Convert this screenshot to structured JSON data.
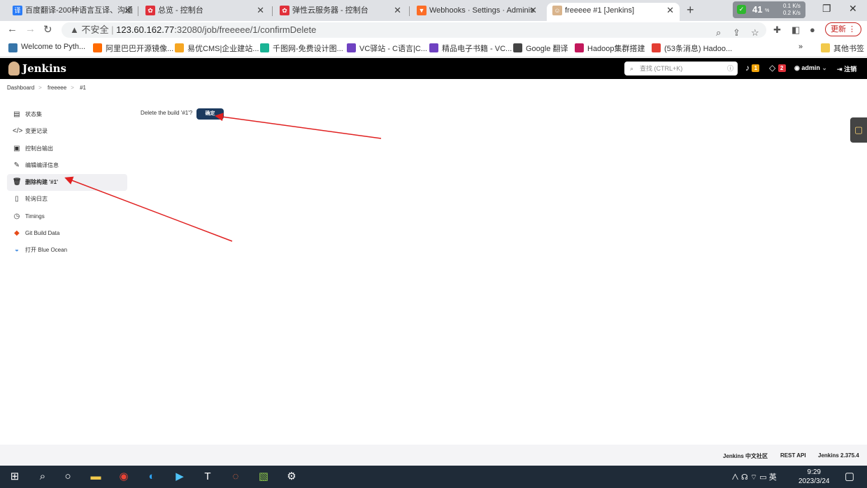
{
  "browser": {
    "tabs": [
      {
        "title": "百度翻译-200种语言互译、沟通",
        "icon": "baidu-translate-icon",
        "color": "#2b7cf7",
        "glyph": "译"
      },
      {
        "title": "总览 - 控制台",
        "icon": "huawei-cloud-icon",
        "color": "#e0303a",
        "glyph": "✿"
      },
      {
        "title": "弹性云服务器 - 控制台",
        "icon": "huawei-cloud-icon",
        "color": "#e0303a",
        "glyph": "✿"
      },
      {
        "title": "Webhooks · Settings · Adminis",
        "icon": "gitlab-icon",
        "color": "#fc6d26",
        "glyph": "▼"
      },
      {
        "title": "freeeee #1 [Jenkins]",
        "icon": "jenkins-icon",
        "color": "#d9b48c",
        "glyph": "☺"
      }
    ],
    "new_tab": "+",
    "ext_badge": {
      "value": "41",
      "unit": "%",
      "up": "0.1 K/s",
      "down": "0.2 K/s"
    },
    "address": {
      "security": "不安全",
      "host": "123.60.162.77",
      "rest": ":32080/job/freeeee/1/confirmDelete"
    },
    "update_label": "更新",
    "bookmarks": [
      {
        "label": "Welcome to Pyth...",
        "color": "#3775a9"
      },
      {
        "label": "阿里巴巴开源镜像...",
        "color": "#ff6a00"
      },
      {
        "label": "易优CMS|企业建站...",
        "color": "#f5a623"
      },
      {
        "label": "千图网-免费设计图...",
        "color": "#1ab394"
      },
      {
        "label": "VC驿站 - C语言|C...",
        "color": "#6f42c1"
      },
      {
        "label": "精品电子书籍 - VC...",
        "color": "#6f42c1"
      },
      {
        "label": "Google 翻译",
        "color": "#444"
      },
      {
        "label": "Hadoop集群搭建",
        "color": "#c2185b"
      },
      {
        "label": "(53条消息) Hadoo...",
        "color": "#e33e33"
      }
    ],
    "bookmarks_more": "»",
    "other_bookmarks": "其他书签"
  },
  "jenkins": {
    "title": "Jenkins",
    "search_placeholder": "查找 (CTRL+K)",
    "notifications_count": "1",
    "security_count": "2",
    "user": "admin",
    "logout": "注销",
    "breadcrumb": [
      "Dashboard",
      "freeeee",
      "#1"
    ],
    "sidebar": [
      {
        "label": "状态集",
        "icon": "document-icon",
        "glyph": "▤"
      },
      {
        "label": "变更记录",
        "icon": "code-icon",
        "glyph": "</>"
      },
      {
        "label": "控制台输出",
        "icon": "terminal-icon",
        "glyph": "▣"
      },
      {
        "label": "编辑编译信息",
        "icon": "edit-icon",
        "glyph": "✎"
      },
      {
        "label": "删除构建 '#1'",
        "icon": "trash-icon",
        "glyph": "🗑"
      },
      {
        "label": "轮询日志",
        "icon": "clipboard-icon",
        "glyph": "▯"
      },
      {
        "label": "Timings",
        "icon": "clock-icon",
        "glyph": "◷"
      },
      {
        "label": "Git Build Data",
        "icon": "git-icon",
        "glyph": "◆"
      },
      {
        "label": "打开 Blue Ocean",
        "icon": "blue-ocean-icon",
        "glyph": "◒"
      }
    ],
    "active_index": 4,
    "confirm_text": "Delete the build '#1'?",
    "confirm_button": "确定",
    "footer": {
      "community": "Jenkins 中文社区",
      "rest_api": "REST API",
      "version": "Jenkins 2.375.4"
    }
  },
  "taskbar": {
    "tray": "∧ ☊ ⌔ ▭ 英",
    "time": "9:29",
    "date": "2023/3/24"
  },
  "colors": {
    "annotation_arrow": "#e02020",
    "confirm_button": "#1c3a5e"
  }
}
